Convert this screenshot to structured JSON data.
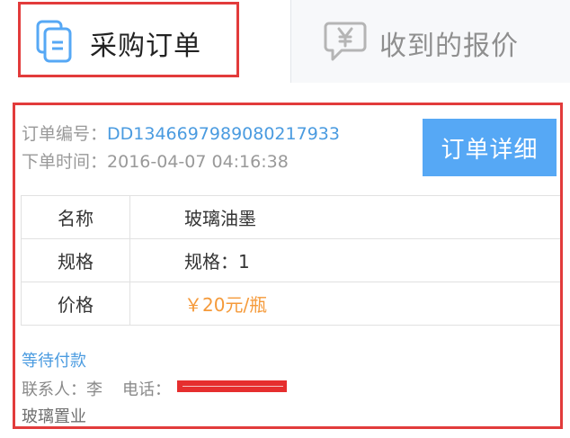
{
  "tabs": {
    "purchase": {
      "label": "采购订单",
      "icon": "document-list-icon",
      "active": true
    },
    "quotes": {
      "label": "收到的报价",
      "icon": "yen-chat-bubble-icon",
      "active": false
    }
  },
  "order": {
    "number_label": "订单编号：",
    "number_value": "DD1346697989080217933",
    "time_label": "下单时间：",
    "time_value": "2016-04-07 04:16:38",
    "detail_button": "订单详细",
    "rows": [
      {
        "key": "名称",
        "value": "玻璃油墨"
      },
      {
        "key": "规格",
        "value": "规格：1"
      },
      {
        "key": "价格",
        "value": "￥20元/瓶"
      }
    ],
    "status": "等待付款",
    "contact_label": "联系人：",
    "contact_name": "李",
    "phone_label": "电话：",
    "company": "玻璃置业"
  },
  "colors": {
    "accent_blue": "#56a8f5",
    "link_blue": "#4a9be0",
    "price_orange": "#f59a3a",
    "highlight_red": "#e23b3b"
  }
}
